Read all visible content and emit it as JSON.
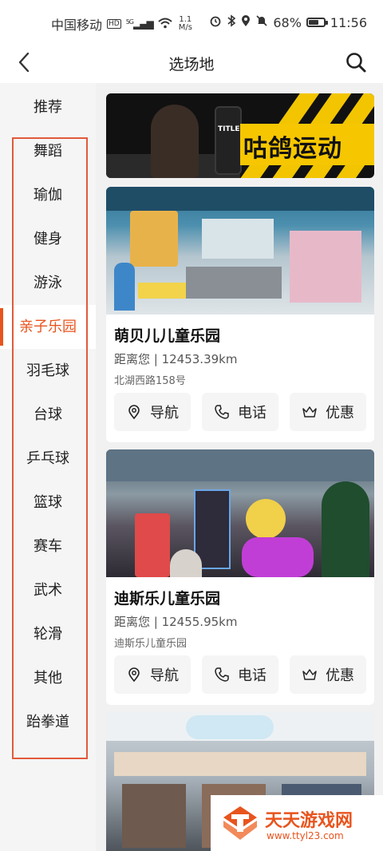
{
  "status_bar": {
    "carrier": "中国移动",
    "network_badge": "HD",
    "signal_label": "5G",
    "speed_value": "1.1",
    "speed_unit": "M/s",
    "battery_percent": "68%",
    "battery_level": 0.68,
    "time": "11:56",
    "icons": [
      "alarm-icon",
      "bluetooth-icon",
      "location-icon",
      "mute-icon",
      "battery-icon"
    ]
  },
  "header": {
    "title": "选场地",
    "icons": [
      "back-arrow-icon",
      "search-icon"
    ]
  },
  "sidebar": {
    "items": [
      {
        "label": "推荐"
      },
      {
        "label": "舞蹈"
      },
      {
        "label": "瑜伽"
      },
      {
        "label": "健身"
      },
      {
        "label": "游泳"
      },
      {
        "label": "亲子乐园"
      },
      {
        "label": "羽毛球"
      },
      {
        "label": "台球"
      },
      {
        "label": "乒乓球"
      },
      {
        "label": "篮球"
      },
      {
        "label": "赛车"
      },
      {
        "label": "武术"
      },
      {
        "label": "轮滑"
      },
      {
        "label": "其他"
      },
      {
        "label": "跆拳道"
      }
    ],
    "active_label": "亲子乐园"
  },
  "banner": {
    "text": "咕鸽运动",
    "bag_text": "TITLE"
  },
  "venues": [
    {
      "name": "萌贝儿儿童乐园",
      "distance": "距离您 | 12453.39km",
      "address": "北湖西路158号",
      "buttons": {
        "navigate": "导航",
        "phone": "电话",
        "discount": "优惠"
      }
    },
    {
      "name": "迪斯乐儿童乐园",
      "distance": "距离您 | 12455.95km",
      "address": "迪斯乐儿童乐园",
      "buttons": {
        "navigate": "导航",
        "phone": "电话",
        "discount": "优惠"
      }
    }
  ],
  "watermark": {
    "title": "天天游戏网",
    "url": "www.ttyl23.com"
  },
  "colors": {
    "accent": "#e8541e",
    "frame": "#e25a3b",
    "sidebar_bg": "#f5f5f5",
    "main_bg": "#f1f1f1"
  }
}
